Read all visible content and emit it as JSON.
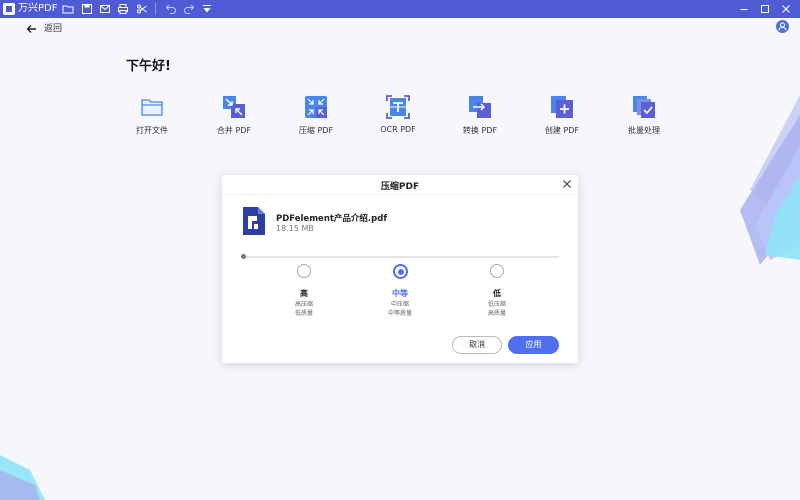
{
  "app": {
    "title": "万兴PDF"
  },
  "toolbar": {
    "icons": [
      "open-folder-icon",
      "save-icon",
      "mail-icon",
      "print-icon",
      "scissors-icon",
      "undo-icon",
      "redo-icon",
      "dropdown-icon"
    ]
  },
  "window_controls": [
    "minimize-icon",
    "maximize-icon",
    "close-icon"
  ],
  "nav": {
    "back_label": "返回"
  },
  "greeting": "下午好!",
  "tools": [
    {
      "label": "打开文件",
      "icon": "folder-icon"
    },
    {
      "label": "合并 PDF",
      "icon": "merge-icon"
    },
    {
      "label": "压缩 PDF",
      "icon": "compress-icon"
    },
    {
      "label": "OCR PDF",
      "icon": "ocr-icon"
    },
    {
      "label": "转换 PDF",
      "icon": "convert-icon"
    },
    {
      "label": "创建 PDF",
      "icon": "create-icon"
    },
    {
      "label": "批量处理",
      "icon": "batch-icon"
    }
  ],
  "dialog": {
    "title": "压缩PDF",
    "file": {
      "name": "PDFelement产品介绍.pdf",
      "size": "18.15 MB"
    },
    "options": [
      {
        "name": "高",
        "line1": "高压缩",
        "line2": "低质量",
        "selected": false
      },
      {
        "name": "中等",
        "line1": "中压缩",
        "line2": "中等质量",
        "selected": true
      },
      {
        "name": "低",
        "line1": "低压缩",
        "line2": "高质量",
        "selected": false
      }
    ],
    "cancel_label": "取消",
    "apply_label": "应用"
  },
  "colors": {
    "titlebar": "#4f5bd5",
    "accent": "#4f6ff0",
    "background": "#f6f7fb"
  }
}
